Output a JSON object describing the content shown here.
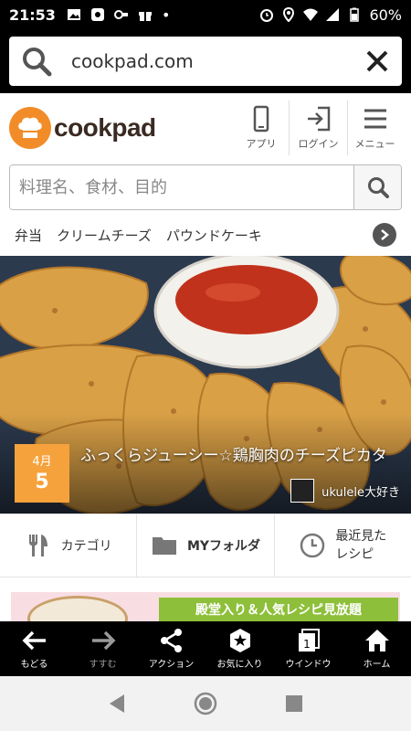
{
  "status_bar": {
    "time": "21:53",
    "battery": "60%",
    "dot": "•"
  },
  "url_bar": {
    "url": "cookpad.com",
    "search_icon": "search-icon",
    "close_icon": "close-icon"
  },
  "header": {
    "logo_text": "cookpad",
    "nav": [
      {
        "label": "アプリ",
        "icon": "smartphone-icon"
      },
      {
        "label": "ログイン",
        "icon": "login-icon"
      },
      {
        "label": "メニュー",
        "icon": "menu-icon"
      }
    ]
  },
  "search": {
    "placeholder": "料理名、食材、目的"
  },
  "keywords": [
    "弁当",
    "クリームチーズ",
    "パウンドケーキ"
  ],
  "hero": {
    "month": "4月",
    "day": "5",
    "title": "ふっくらジューシー☆鶏胸肉のチーズピカタ",
    "author": "ukulele大好き"
  },
  "tabs": [
    {
      "label": "カテゴリ",
      "icon": "fork-knife-icon"
    },
    {
      "label": "MYフォルダ",
      "icon": "folder-icon"
    },
    {
      "label": "最近見た\nレシピ",
      "icon": "clock-icon"
    }
  ],
  "promo": {
    "text": "殿堂入り＆人気レシピ見放題"
  },
  "browser_bar": [
    {
      "label": "もどる",
      "icon": "back-arrow-icon"
    },
    {
      "label": "すすむ",
      "icon": "forward-arrow-icon"
    },
    {
      "label": "アクション",
      "icon": "share-icon"
    },
    {
      "label": "お気に入り",
      "icon": "star-icon"
    },
    {
      "label": "ウインドウ",
      "icon": "window-icon",
      "count": "1"
    },
    {
      "label": "ホーム",
      "icon": "home-icon"
    }
  ],
  "colors": {
    "brand_orange": "#f28c28",
    "date_badge": "#f6a23c",
    "promo_green": "#8dbf3a"
  }
}
